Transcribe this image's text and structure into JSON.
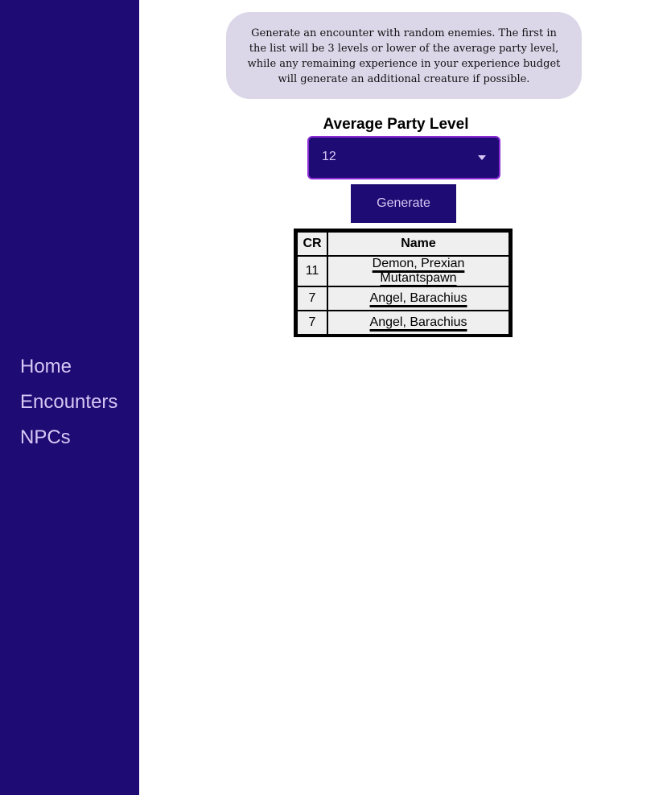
{
  "sidebar": {
    "items": [
      {
        "label": "Home"
      },
      {
        "label": "Encounters"
      },
      {
        "label": "NPCs"
      }
    ]
  },
  "main": {
    "description": "Generate an encounter with random enemies. The first in the list will be 3 levels or lower of the average party level, while any remaining experience in your experience budget will generate an additional creature if possible.",
    "party_level_label": "Average Party Level",
    "party_level_value": "12",
    "generate_label": "Generate",
    "table": {
      "headers": [
        "CR",
        "Name"
      ],
      "rows": [
        {
          "cr": "11",
          "name": "Demon, Prexian Mutantspawn"
        },
        {
          "cr": "7",
          "name": "Angel, Barachius"
        },
        {
          "cr": "7",
          "name": "Angel, Barachius"
        }
      ]
    }
  },
  "colors": {
    "sidebar_bg": "#1e0b73",
    "nav_text": "#d7c7f5",
    "description_bg": "#dbd7e9",
    "select_border": "#8a2bd6",
    "table_bg": "#efefef"
  }
}
